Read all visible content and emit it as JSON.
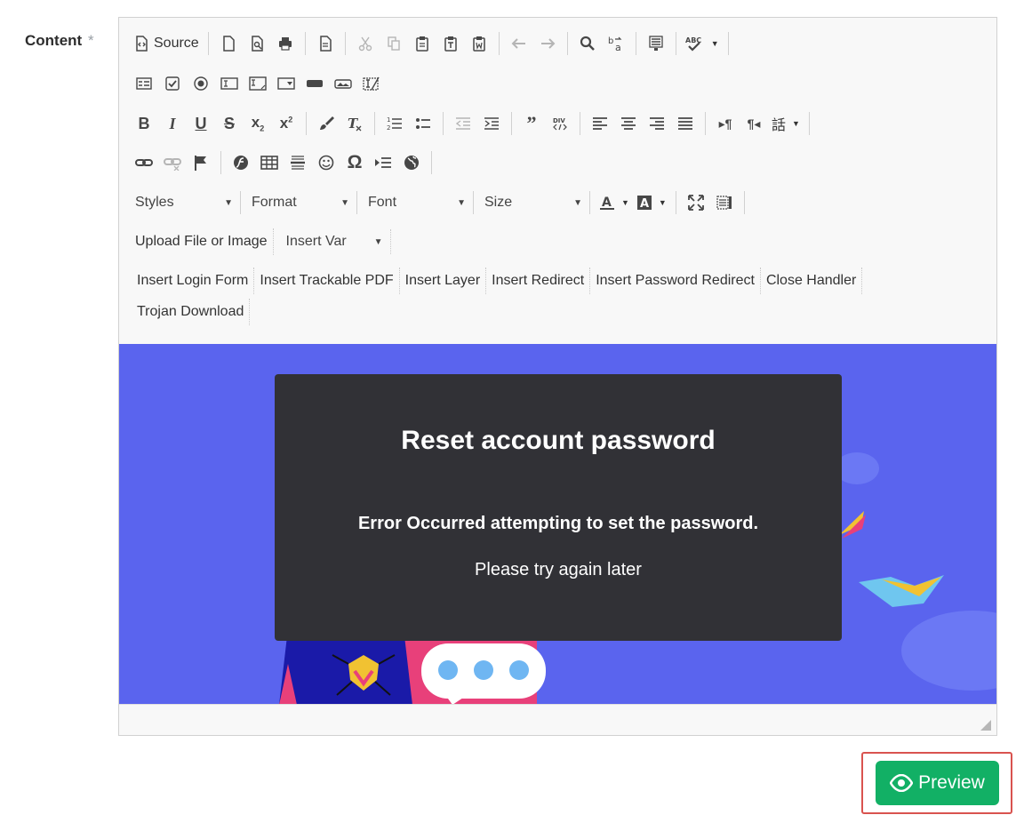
{
  "field": {
    "label": "Content",
    "required_mark": "*"
  },
  "toolbar": {
    "source_label": "Source",
    "styles": "Styles",
    "format": "Format",
    "font": "Font",
    "size": "Size",
    "upload_label": "Upload File or Image",
    "insert_var_label": "Insert Var",
    "plugins": [
      "Insert Login Form",
      "Insert Trackable PDF",
      "Insert Layer",
      "Insert Redirect",
      "Insert Password Redirect",
      "Close Handler",
      "Trojan Download"
    ]
  },
  "content": {
    "background_color": "#5a64ee",
    "modal_title": "Reset account password",
    "error_message": "Error Occurred attempting to set the password.",
    "sub_message": "Please try again later"
  },
  "actions": {
    "preview_label": "Preview",
    "preview_color": "#12b065",
    "highlight_color": "#d9534f"
  }
}
